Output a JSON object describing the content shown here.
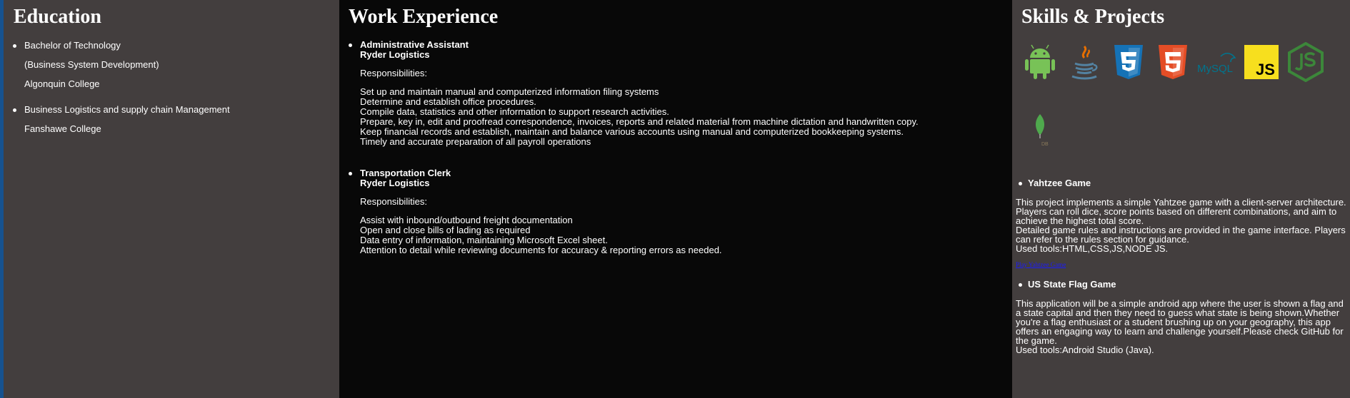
{
  "education": {
    "heading": "Education",
    "items": [
      {
        "lines": [
          "Bachelor of Technology",
          "(Business System Development)",
          "Algonquin College"
        ]
      },
      {
        "lines": [
          "Business Logistics and supply chain Management",
          "Fanshawe College"
        ]
      }
    ]
  },
  "work": {
    "heading": "Work Experience",
    "jobs": [
      {
        "title": "Administrative Assistant",
        "company": "Ryder Logistics",
        "resp_label": "Responsibilities:",
        "duties": [
          "Set up and maintain manual and computerized information filing systems",
          "Determine and establish office procedures.",
          "Compile data, statistics and other information to support research activities.",
          "Prepare, key in, edit and proofread correspondence, invoices, reports and related material from machine dictation and handwritten copy.",
          "Keep financial records and establish, maintain and balance various accounts using manual and computerized bookkeeping systems.",
          "Timely and accurate preparation of all payroll operations"
        ]
      },
      {
        "title": "Transportation Clerk",
        "company": "Ryder Logistics",
        "resp_label": "Responsibilities:",
        "duties": [
          "Assist with inbound/outbound freight documentation",
          "Open and close bills of lading as required",
          "Data entry of information, maintaining Microsoft Excel sheet.",
          "Attention to detail while reviewing documents for accuracy & reporting errors as needed."
        ]
      }
    ]
  },
  "skills": {
    "heading": "Skills & Projects",
    "icons": {
      "mysql_text": "MySQL",
      "js_text": "JS",
      "mongo_text": "DB",
      "colors": {
        "android": "#78c257",
        "java_red": "#e76f00",
        "java_blue": "#5382a1",
        "css": "#1572b6",
        "html": "#e44d26",
        "mysql": "#00758f",
        "js_bg": "#f7df1e",
        "node": "#3c873a",
        "mongo": "#4fa94d"
      }
    },
    "projects": [
      {
        "title": "Yahtzee Game",
        "desc": [
          "This project implements a simple Yahtzee game with a client-server architecture. Players can roll dice, score points based on different combinations, and aim to achieve the highest total score.",
          "Detailed game rules and instructions are provided in the game interface. Players can refer to the rules section for guidance.",
          "Used tools:HTML,CSS,JS,NODE JS."
        ],
        "link": "Play Yahtzee Game"
      },
      {
        "title": "US State Flag Game",
        "desc": [
          "This application will be a simple android app where the user is shown a flag and a state capital and then they need to guess what state is being shown.Whether you're a flag enthusiast or a student brushing up on your geography, this app offers an engaging way to learn and challenge yourself.Please check GitHub for the game.",
          "Used tools:Android Studio (Java)."
        ]
      }
    ]
  }
}
